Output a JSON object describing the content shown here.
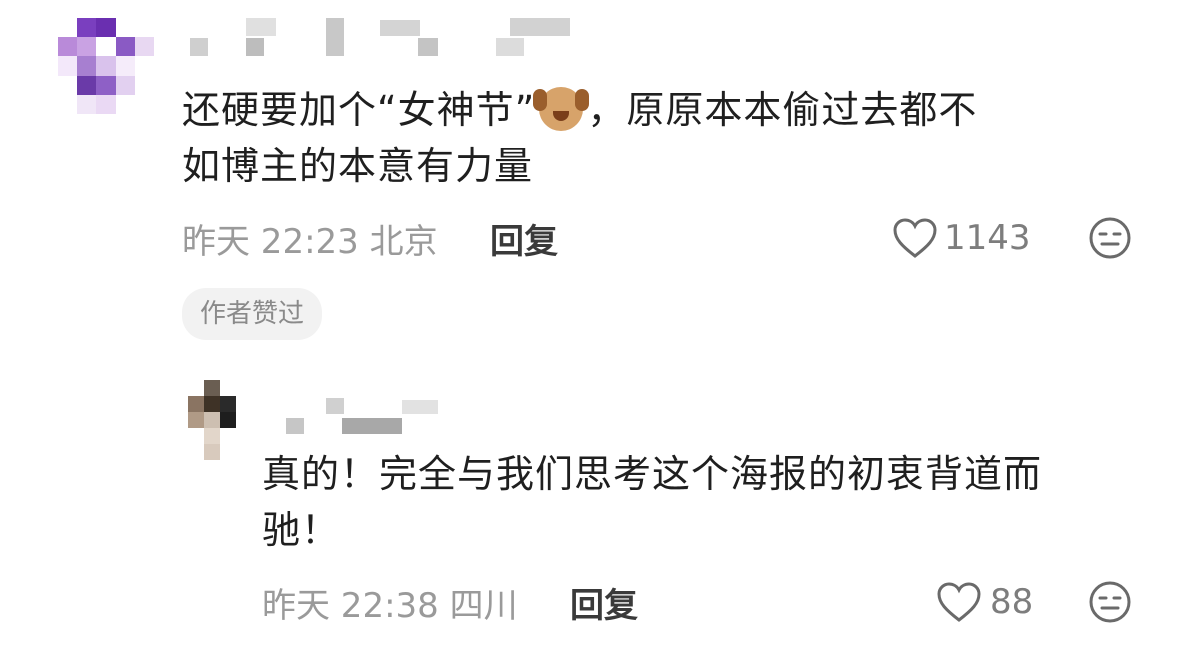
{
  "comments": [
    {
      "text_before_emoji": "还硬要加个“女神节”",
      "emoji_icon": "laughing-dog-emoji",
      "text_after_emoji": "，原原本本偷过去都不",
      "text_line2": "如博主的本意有力量",
      "time": "昨天 22:23",
      "location": "北京",
      "reply_label": "回复",
      "likes": "1143",
      "badge": "作者赞过"
    },
    {
      "text_line1": "真的！完全与我们思考这个海报的初衷背道而",
      "text_line2": "驰！",
      "time": "昨天 22:38",
      "location": "四川",
      "reply_label": "回复",
      "likes": "88"
    }
  ]
}
